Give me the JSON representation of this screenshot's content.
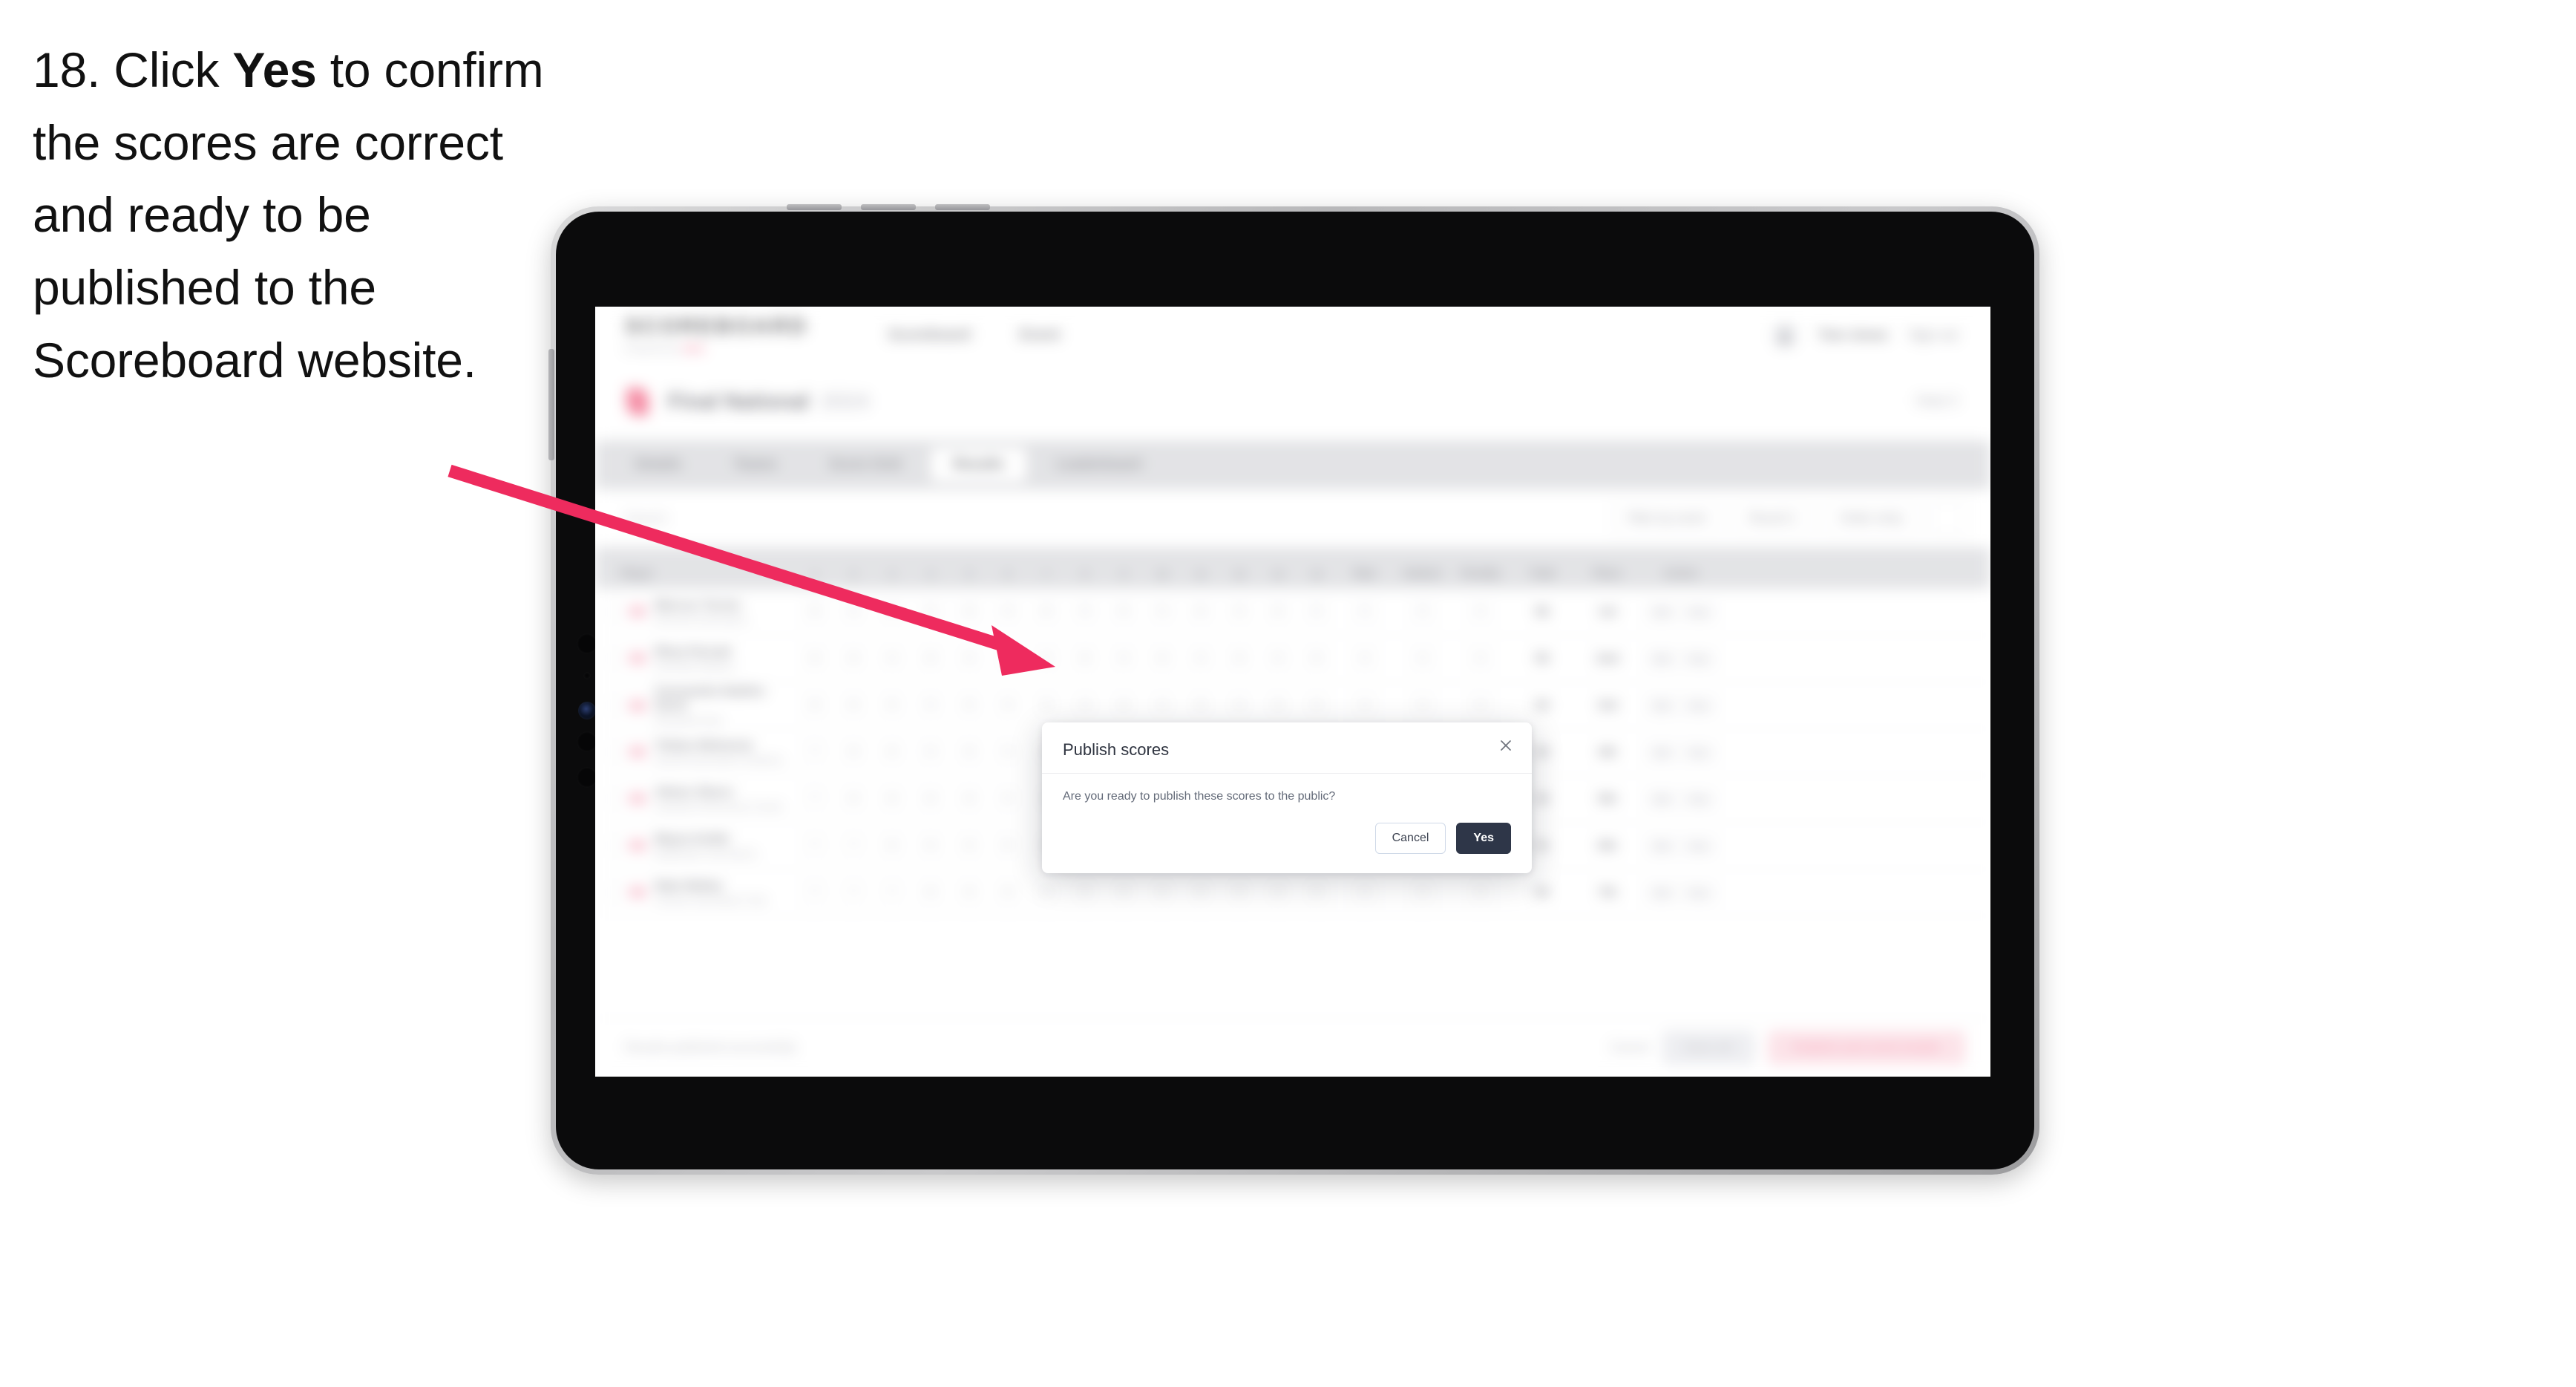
{
  "instruction": {
    "step_number": "18.",
    "text_before": " Click ",
    "bold_word": "Yes",
    "text_after": " to confirm the scores are correct and ready to be published to the Scoreboard website."
  },
  "annotation": {
    "arrow_color": "#ee2b5e",
    "points_to": "yes-button"
  },
  "device": {
    "type": "tablet",
    "frame_color": "#b8b8ba",
    "bezel_color": "#0b0b0c"
  },
  "app": {
    "header": {
      "wordmark": "SCOREBOARD",
      "tagline": "Powered by",
      "tagline_accent": "SGA",
      "nav": [
        "Scoreboard",
        "Event"
      ],
      "user_name": "Tom Jones",
      "sign_out": "Sign out"
    },
    "competition": {
      "name": "Final National",
      "year": "2024",
      "meta": "Heat 3"
    },
    "tabs": [
      {
        "label": "Details",
        "active": false
      },
      {
        "label": "Teams",
        "active": false
      },
      {
        "label": "Score Grid",
        "active": false
      },
      {
        "label": "Results",
        "active": true
      },
      {
        "label": "Leaderboard",
        "active": false
      }
    ],
    "filters": {
      "search_placeholder": "Search",
      "chips": [
        "Filter by event",
        "Round 1"
      ],
      "sort_chip": "Order entry"
    },
    "table": {
      "columns": {
        "player": "Player",
        "judges": [
          "1",
          "2",
          "3",
          "4",
          "5",
          "6",
          "7",
          "8",
          "9",
          "10",
          "11",
          "12",
          "13",
          "14"
        ],
        "raw": "Raw",
        "deduction": "Deduct",
        "penalty": "Penalty",
        "total": "Total",
        "place": "Place",
        "actions": "Action"
      },
      "rows": [
        {
          "name": "Marcus Turner",
          "club": "Elmwood Gymnastics",
          "scores": [
            "8",
            "9",
            "8",
            "9",
            "8",
            "9",
            "8",
            "9",
            "8",
            "9",
            "8",
            "9",
            "8",
            "9"
          ],
          "total": "56",
          "place": "1st",
          "actions": [
            "Edit",
            "View"
          ]
        },
        {
          "name": "Rhea Parvati",
          "club": "Northside Athletics",
          "scores": [
            "8",
            "8",
            "9",
            "8",
            "9",
            "8",
            "9",
            "8",
            "9",
            "8",
            "9",
            "8",
            "9",
            "8"
          ],
          "total": "55",
          "place": "2nd",
          "actions": [
            "Edit",
            "View"
          ]
        },
        {
          "name": "Cassandra Nadine Davis",
          "club": "Riverbend Club",
          "scores": [
            "8",
            "8",
            "8",
            "9",
            "8",
            "9",
            "8",
            "9",
            "8",
            "9",
            "8",
            "9",
            "8",
            "9"
          ],
          "total": "54",
          "place": "3rd",
          "actions": [
            "Edit",
            "View"
          ]
        },
        {
          "name": "Tobias Mokoena",
          "club": "Summit Gymnastics Academy",
          "scores": [
            "7",
            "8",
            "8",
            "9",
            "8",
            "9",
            "8",
            "9",
            "8",
            "9",
            "8",
            "9",
            "8",
            "8"
          ],
          "total": "53",
          "place": "4th",
          "actions": [
            "Edit",
            "View"
          ]
        },
        {
          "name": "Aileen Okoro",
          "club": "Lakeside Performance Centre",
          "scores": [
            "7",
            "8",
            "8",
            "8",
            "8",
            "9",
            "8",
            "9",
            "8",
            "9",
            "8",
            "9",
            "8",
            "8"
          ],
          "total": "52",
          "place": "5th",
          "actions": [
            "Edit",
            "View"
          ]
        },
        {
          "name": "Mayra Kettle",
          "club": "Brightwater Gymnastics",
          "scores": [
            "7",
            "7",
            "8",
            "8",
            "8",
            "8",
            "8",
            "9",
            "8",
            "9",
            "8",
            "8",
            "8",
            "8"
          ],
          "total": "51",
          "place": "6th",
          "actions": [
            "Edit",
            "View"
          ]
        },
        {
          "name": "Nate Bailey",
          "club": "Fairview Gymnastics Club",
          "scores": [
            "7",
            "7",
            "7",
            "8",
            "8",
            "8",
            "8",
            "8",
            "8",
            "8",
            "8",
            "8",
            "8",
            "8"
          ],
          "total": "50",
          "place": "7th",
          "actions": [
            "Edit",
            "View"
          ]
        }
      ]
    },
    "footer": {
      "note": "Results published successfully",
      "cancel_link": "Cancel",
      "save_button": "Save all",
      "publish_button": "Publish and send emails"
    }
  },
  "modal": {
    "title": "Publish scores",
    "body": "Are you ready to publish these scores to the public?",
    "cancel_label": "Cancel",
    "confirm_label": "Yes",
    "close_icon": "close-icon",
    "confirm_color": "#2e3648"
  }
}
